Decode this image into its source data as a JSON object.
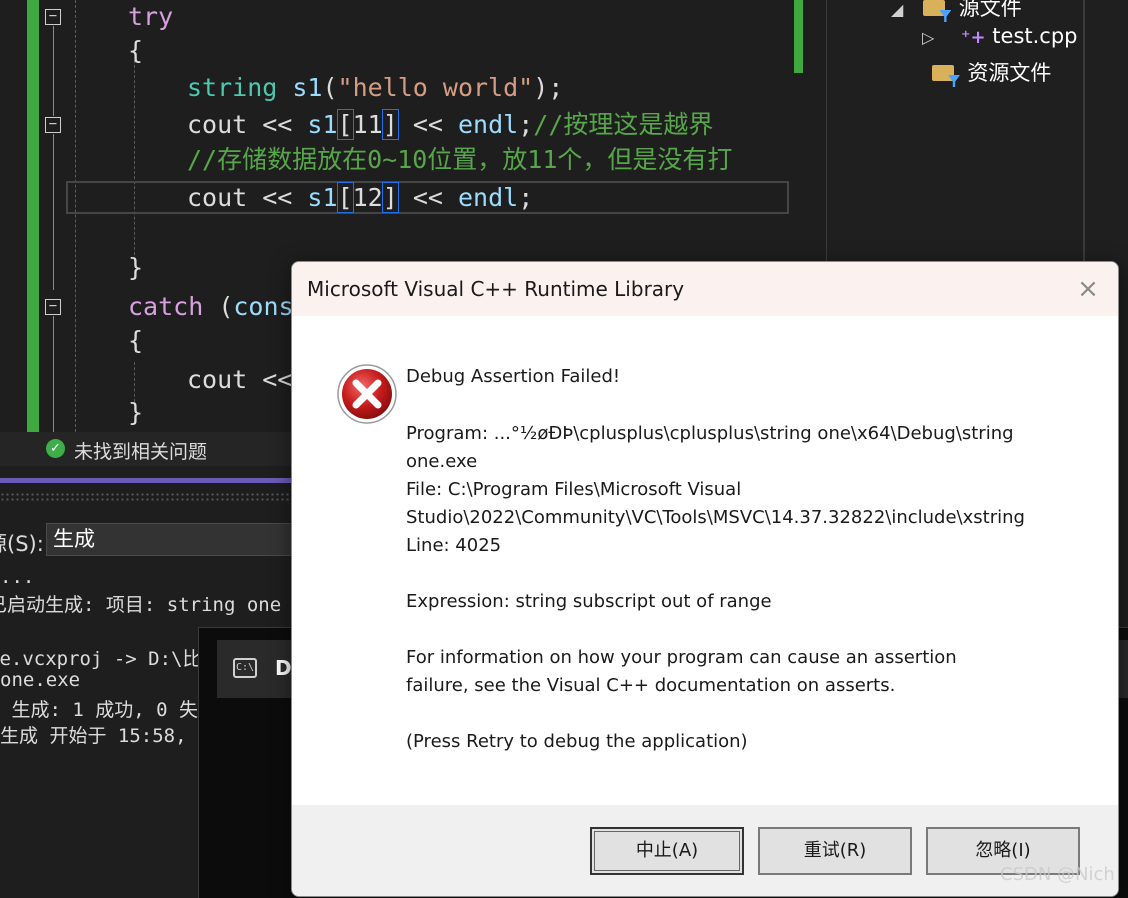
{
  "editor": {
    "lines": {
      "l1_kw": "try",
      "l2": "{",
      "l3_type": "string",
      "l3_var": " s1",
      "l3_open": "(",
      "l3_str": "\"hello world\"",
      "l3_close": ");",
      "l4_a": "cout << ",
      "l4_var": "s1",
      "l4_lb": "[",
      "l4_num": "11",
      "l4_rb": "]",
      "l4_b": " << ",
      "l4_endl": "endl",
      "l4_semi": ";",
      "l4_comment": "//按理这是越界",
      "l5_comment": "//存储数据放在0~10位置，放11个，但是没有打",
      "l6_a": "cout << ",
      "l6_var": "s1",
      "l6_lb": "[",
      "l6_num": "12",
      "l6_rb": "]",
      "l6_b": " << ",
      "l6_endl": "endl",
      "l6_semi": ";",
      "l8": "}",
      "l9_kw": "catch",
      "l9_rest": " (",
      "l9_const": "cons",
      "l10": "{",
      "l11": "cout <<",
      "l12": "}"
    },
    "accent_color": "#3fa93f"
  },
  "status": {
    "issues": "未找到相关问题"
  },
  "solution_explorer": {
    "items": [
      {
        "label": "源文件"
      },
      {
        "label": "test.cpp"
      },
      {
        "label": "资源文件"
      }
    ]
  },
  "output": {
    "source_label": "源(S):",
    "source_value": "生成",
    "lines": [
      "...",
      "已启动生成: 项目: string one",
      "ne.vcxproj -> D:\\比",
      "one.exe",
      " 生成: 1 成功, 0 失",
      "生成 开始于 15:58,"
    ]
  },
  "console": {
    "title": "D"
  },
  "dialog": {
    "title": "Microsoft Visual C++ Runtime Library",
    "close": "×",
    "heading": "Debug Assertion Failed!",
    "program_1": "Program: ...°½øÐÞ\\cplusplus\\cplusplus\\string one\\x64\\Debug\\string",
    "program_2": "one.exe",
    "file_1": "File: C:\\Program Files\\Microsoft Visual",
    "file_2": "Studio\\2022\\Community\\VC\\Tools\\MSVC\\14.37.32822\\include\\xstring",
    "line": "Line: 4025",
    "expression": "Expression: string subscript out of range",
    "info_1": "For information on how your program can cause an assertion",
    "info_2": "failure, see the Visual C++ documentation on asserts.",
    "retry_hint": "(Press Retry to debug the application)",
    "buttons": {
      "abort": "中止(A)",
      "retry": "重试(R)",
      "ignore": "忽略(I)"
    }
  },
  "watermark": "CSDN @Nich"
}
